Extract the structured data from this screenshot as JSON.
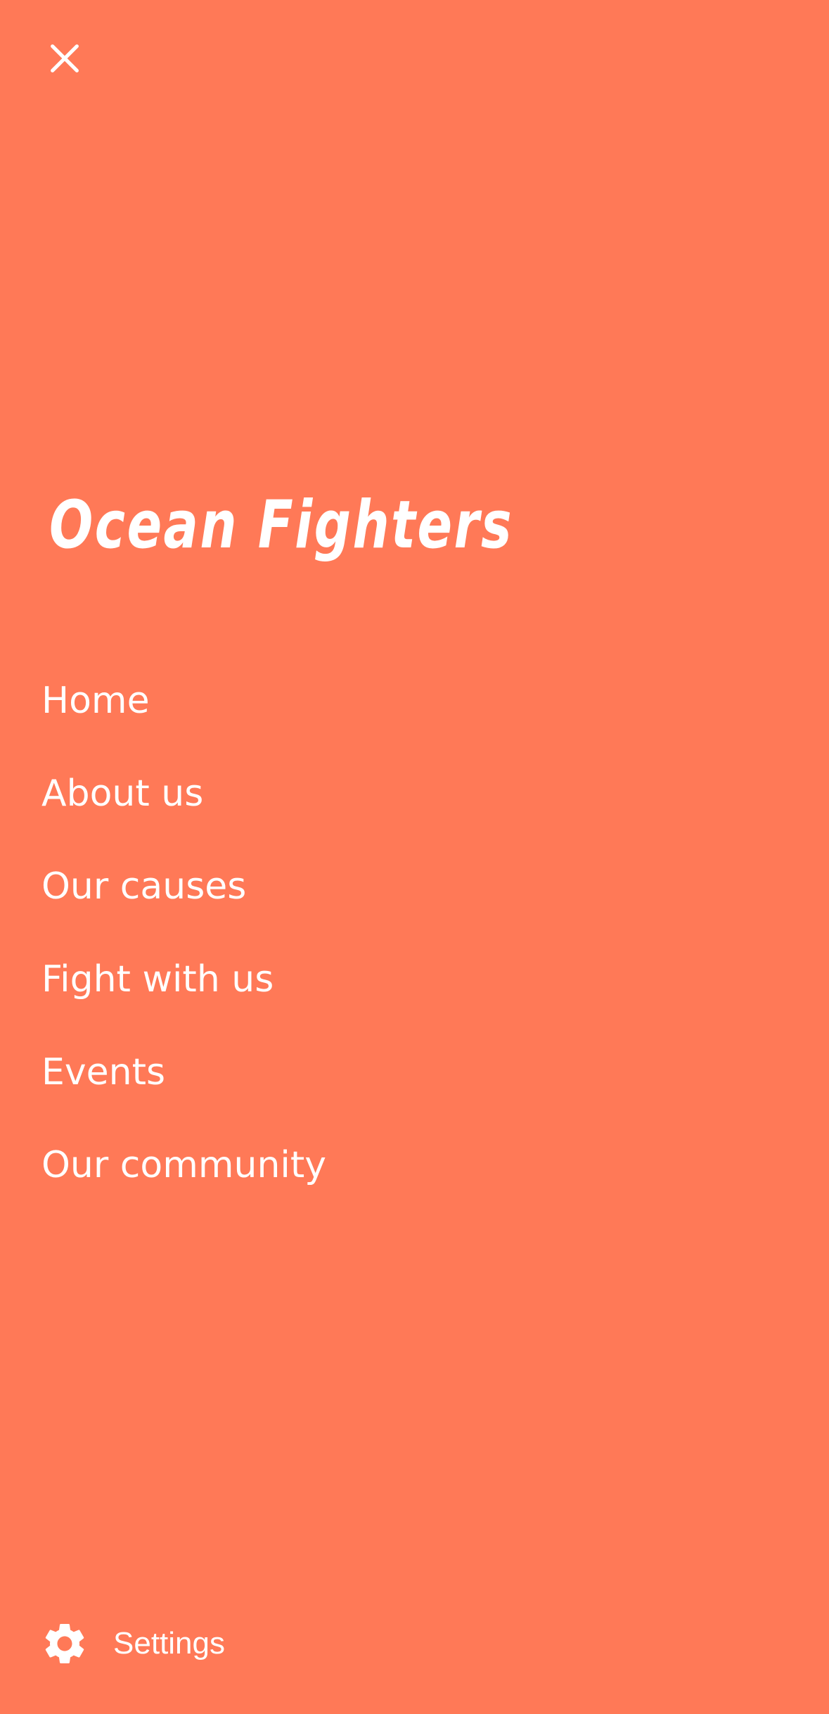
{
  "theme": {
    "background": "#FF7957",
    "foreground": "#FFFFFF"
  },
  "header": {
    "close_icon": "close-icon"
  },
  "brand": {
    "title": "Ocean Fighters"
  },
  "menu": {
    "items": [
      {
        "label": "Home"
      },
      {
        "label": "About us"
      },
      {
        "label": "Our causes"
      },
      {
        "label": "Fight with us"
      },
      {
        "label": "Events"
      },
      {
        "label": "Our community"
      }
    ]
  },
  "footer": {
    "settings_icon": "gear-icon",
    "settings_label": "Settings"
  }
}
